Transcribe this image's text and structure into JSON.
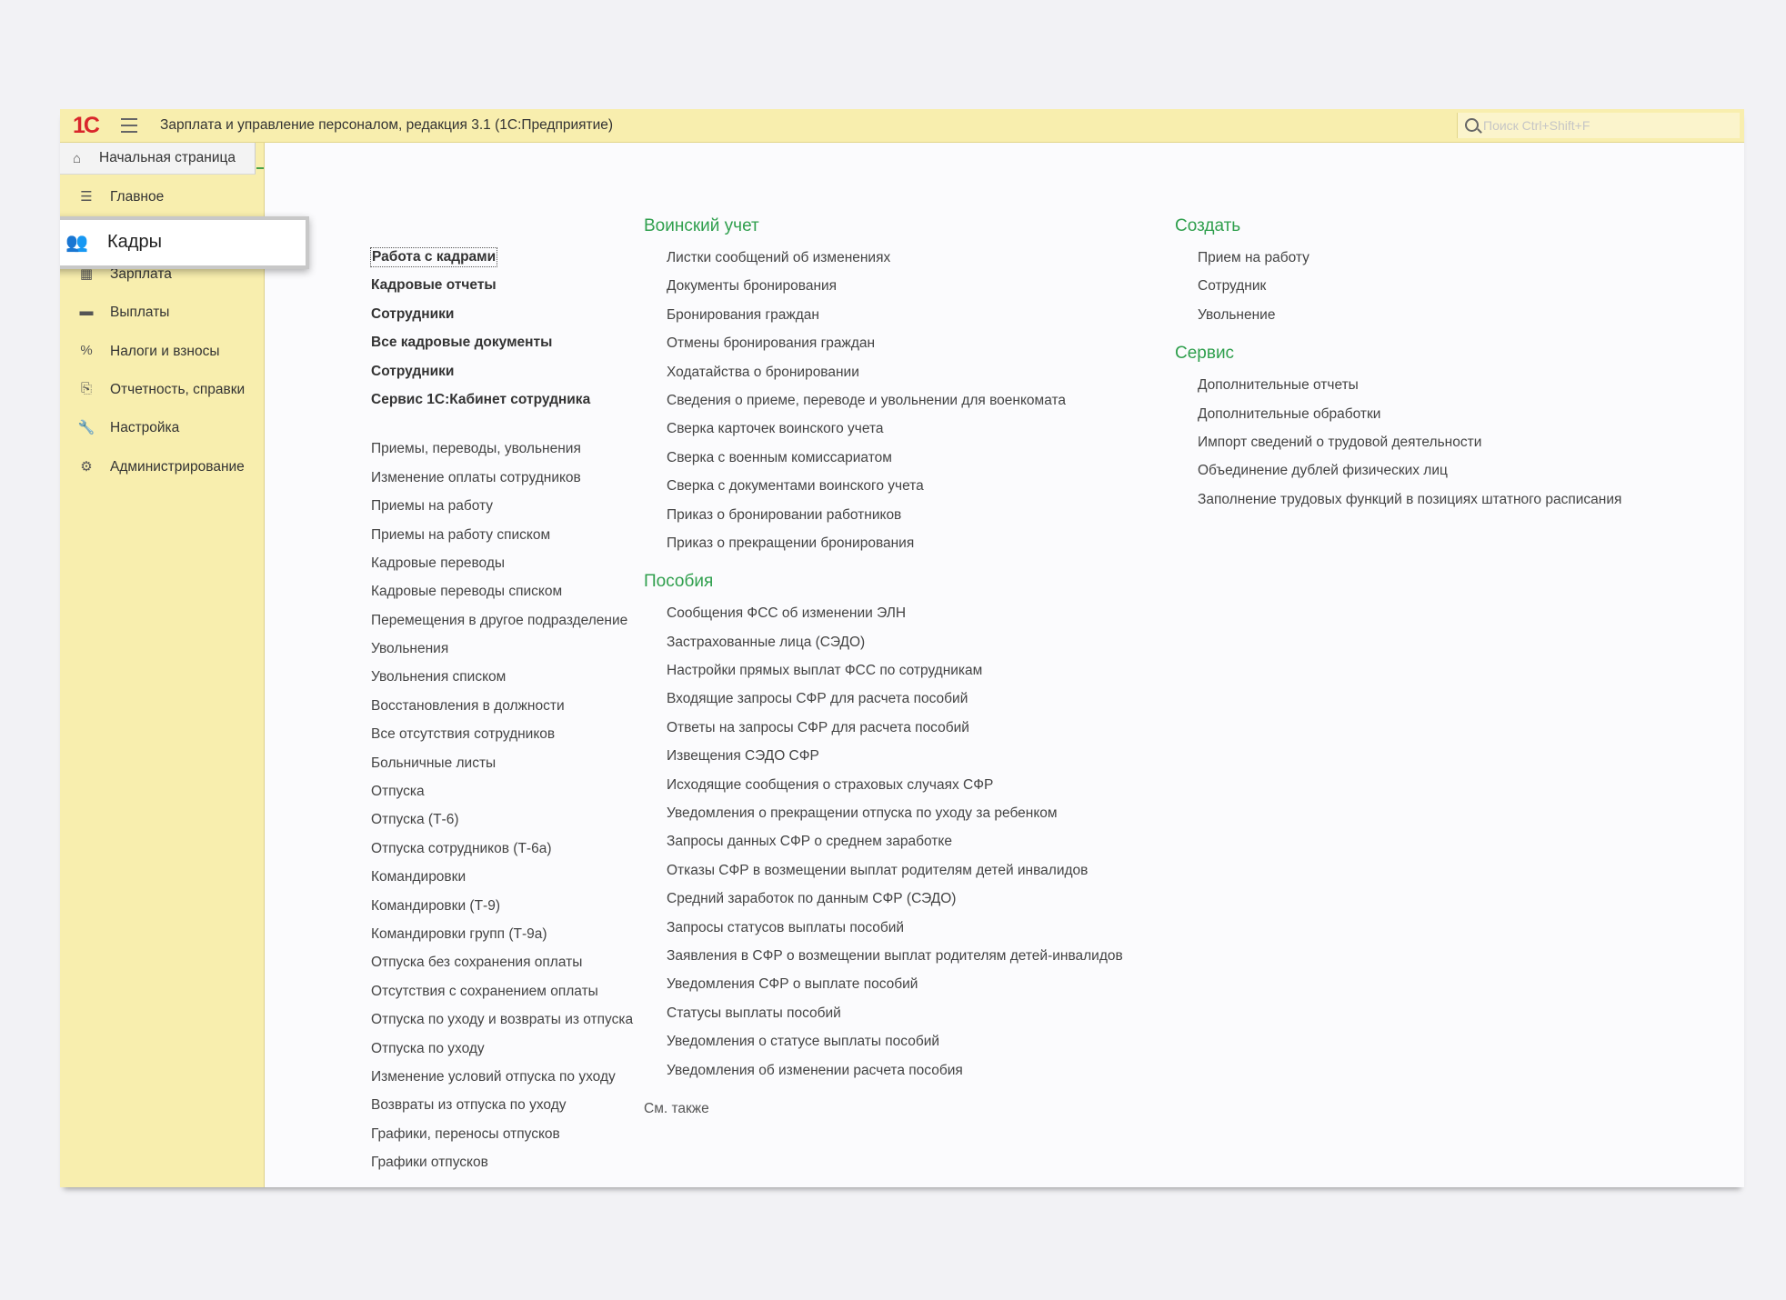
{
  "app": {
    "logo": "1С",
    "title": "Зарплата и управление персоналом, редакция 3.1  (1С:Предприятие)",
    "search_placeholder": "Поиск Ctrl+Shift+F"
  },
  "home_tab": {
    "label": "Начальная страница"
  },
  "sidebar": {
    "items": [
      {
        "label": "Главное",
        "icon": "☰"
      },
      {
        "label": "Кадры",
        "icon": "👥",
        "active": true
      },
      {
        "label": "Зарплата",
        "icon": "▦"
      },
      {
        "label": "Выплаты",
        "icon": "▬"
      },
      {
        "label": "Налоги и взносы",
        "icon": "%"
      },
      {
        "label": "Отчетность, справки",
        "icon": "⎘"
      },
      {
        "label": "Настройка",
        "icon": "🔧"
      },
      {
        "label": "Администрирование",
        "icon": "⚙"
      }
    ]
  },
  "content": {
    "col1_bold": [
      "Работа с кадрами",
      "Кадровые отчеты",
      "Сотрудники",
      "Все кадровые документы",
      "Сотрудники",
      "Сервис 1С:Кабинет сотрудника"
    ],
    "col1_links": [
      "Приемы, переводы, увольнения",
      "Изменение оплаты сотрудников",
      "Приемы на работу",
      "Приемы на работу списком",
      "Кадровые переводы",
      "Кадровые переводы списком",
      "Перемещения в другое подразделение",
      "Увольнения",
      "Увольнения списком",
      "Восстановления в должности",
      "Все отсутствия сотрудников",
      "Больничные листы",
      "Отпуска",
      "Отпуска (Т-6)",
      "Отпуска сотрудников (Т-6а)",
      "Командировки",
      "Командировки (Т-9)",
      "Командировки групп (Т-9а)",
      "Отпуска без сохранения оплаты",
      "Отсутствия с сохранением оплаты",
      "Отпуска по уходу и возвраты из отпуска",
      "Отпуска по уходу",
      "Изменение условий отпуска по уходу",
      "Возвраты из отпуска по уходу",
      "Графики, переносы отпусков",
      "Графики отпусков"
    ],
    "military": {
      "title": "Воинский учет",
      "links": [
        "Листки сообщений об изменениях",
        "Документы бронирования",
        "Бронирования граждан",
        "Отмены бронирования граждан",
        "Ходатайства о бронировании",
        "Сведения о приеме, переводе и увольнении для военкомата",
        "Сверка карточек воинского учета",
        "Сверка с военным комиссариатом",
        "Сверка с документами воинского учета",
        "Приказ о бронировании работников",
        "Приказ о прекращении бронирования"
      ]
    },
    "benefits": {
      "title": "Пособия",
      "links": [
        "Сообщения ФСС об изменении ЭЛН",
        "Застрахованные лица (СЭДО)",
        "Настройки прямых выплат ФСС по сотрудникам",
        "Входящие запросы СФР для расчета пособий",
        "Ответы на запросы СФР для расчета пособий",
        "Извещения СЭДО СФР",
        "Исходящие сообщения о страховых случаях СФР",
        "Уведомления о прекращении отпуска по уходу за ребенком",
        "Запросы данных СФР о среднем заработке",
        "Отказы СФР в возмещении выплат родителям детей инвалидов",
        "Средний заработок по данным СФР (СЭДО)",
        "Запросы статусов выплаты пособий",
        "Заявления в СФР о возмещении выплат родителям детей-инвалидов",
        "Уведомления СФР о выплате пособий",
        "Статусы выплаты пособий",
        "Уведомления о статусе выплаты пособий",
        "Уведомления об изменении расчета пособия"
      ]
    },
    "see_also": "См. также",
    "create": {
      "title": "Создать",
      "links": [
        "Прием на работу",
        "Сотрудник",
        "Увольнение"
      ]
    },
    "service": {
      "title": "Сервис",
      "links": [
        "Дополнительные отчеты",
        "Дополнительные обработки",
        "Импорт сведений о трудовой деятельности",
        "Объединение дублей физических лиц",
        "Заполнение трудовых функций в позициях штатного расписания"
      ]
    }
  }
}
